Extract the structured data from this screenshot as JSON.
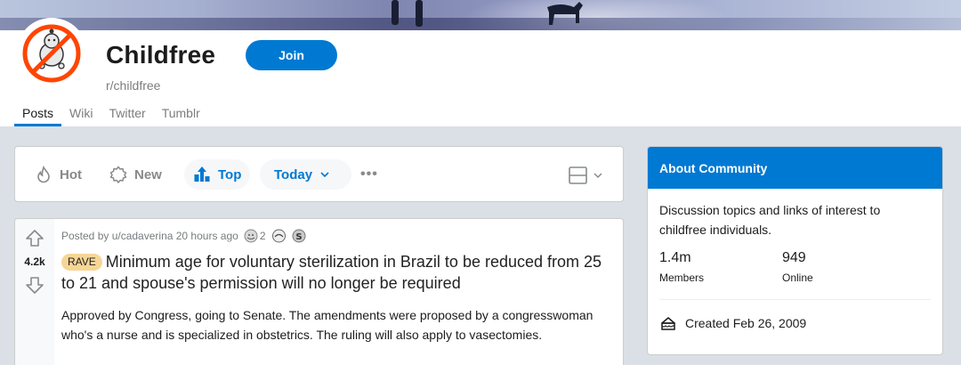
{
  "community": {
    "name": "Childfree",
    "slug": "r/childfree",
    "join_label": "Join"
  },
  "tabs": [
    "Posts",
    "Wiki",
    "Twitter",
    "Tumblr"
  ],
  "sort": {
    "hot": "Hot",
    "new": "New",
    "top": "Top",
    "timeframe": "Today",
    "more": "•••"
  },
  "post": {
    "score": "4.2k",
    "meta": "Posted by u/cadaverina 20 hours ago",
    "award_count": "2",
    "flair": "RAVE",
    "title": "Minimum age for voluntary sterilization in Brazil to be reduced from 25 to 21 and spouse's permission will no longer be required",
    "body": "Approved by Congress, going to Senate. The amendments were proposed by a congresswoman who's a nurse and is specialized in obstetrics. The ruling will also apply to vasectomies."
  },
  "about": {
    "heading": "About Community",
    "description": "Discussion topics and links of interest to childfree individuals.",
    "members_value": "1.4m",
    "members_label": "Members",
    "online_value": "949",
    "online_label": "Online",
    "created": "Created Feb 26, 2009"
  },
  "colors": {
    "accent": "#0079d3",
    "flair_bg": "#f6d696",
    "avatar_ring": "#ff4500"
  }
}
